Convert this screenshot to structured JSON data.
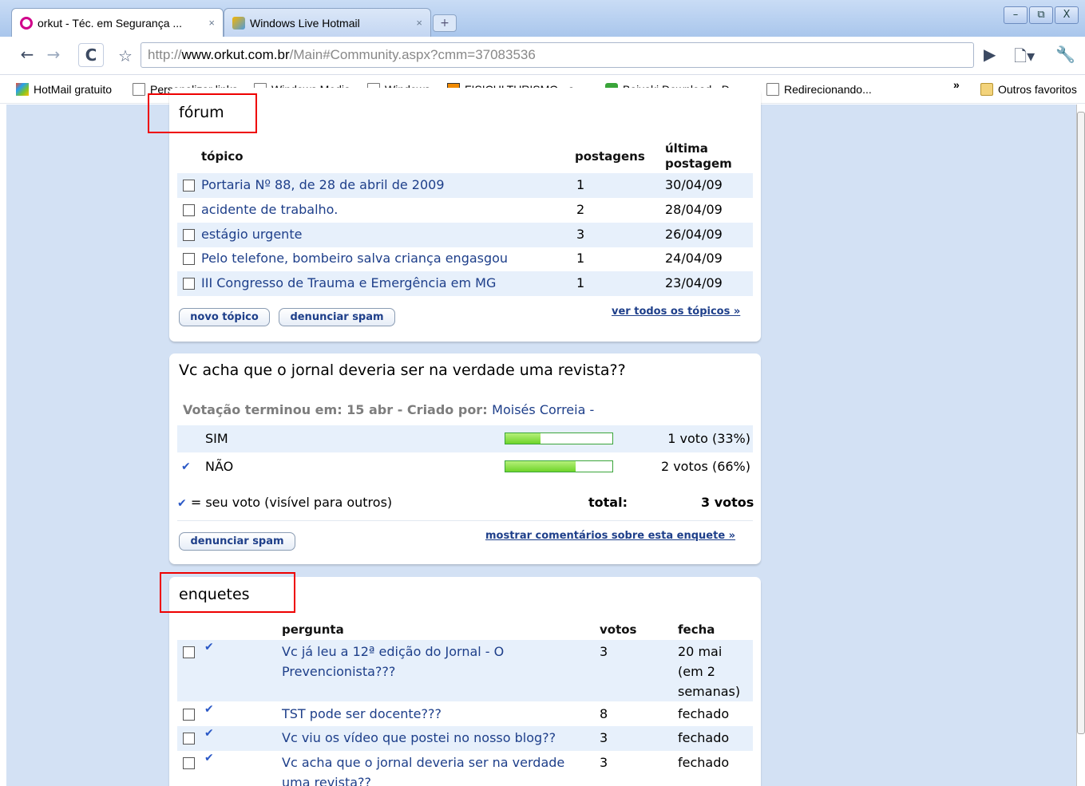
{
  "browser": {
    "tabs": [
      {
        "title": "orkut - Téc. em Segurança ...",
        "close": "×"
      },
      {
        "title": "Windows Live Hotmail",
        "close": "×"
      }
    ],
    "new_tab_label": "+",
    "window_buttons": {
      "minimize": "–",
      "restore": "⧉",
      "close": "X"
    },
    "nav": {
      "back": "←",
      "forward": "→",
      "reload": "C",
      "star": "☆"
    },
    "url_prefix": "http://",
    "url_domain": "www.orkut.com.br",
    "url_path": "/Main#Community.aspx?cmm=37083536",
    "bookmarks": [
      {
        "label": "HotMail gratuito",
        "icon": "hotmail-icon"
      },
      {
        "label": "Personalizar links",
        "icon": "page-icon"
      },
      {
        "label": "Windows Media",
        "icon": "page-icon"
      },
      {
        "label": "Windows",
        "icon": "page-icon"
      },
      {
        "label": "FISICULTURISMO - a...",
        "icon": "fisiculturismo-icon"
      },
      {
        "label": "Baixaki Download - D...",
        "icon": "baixaki-icon"
      },
      {
        "label": "Redirecionando...",
        "icon": "page-icon"
      }
    ],
    "bookmarks_overflow": "»",
    "other_bookmarks": "Outros favoritos"
  },
  "forum": {
    "title": "fórum",
    "headers": {
      "topic": "tópico",
      "posts": "postagens",
      "last_post_1": "última",
      "last_post_2": "postagem"
    },
    "rows": [
      {
        "topic": "Portaria Nº 88, de 28 de abril de 2009",
        "posts": "1",
        "date": "30/04/09"
      },
      {
        "topic": "acidente de trabalho.",
        "posts": "2",
        "date": "28/04/09"
      },
      {
        "topic": "estágio urgente",
        "posts": "3",
        "date": "26/04/09"
      },
      {
        "topic": "Pelo telefone, bombeiro salva criança engasgou",
        "posts": "1",
        "date": "24/04/09"
      },
      {
        "topic": "III Congresso de Trauma e Emergência em MG",
        "posts": "1",
        "date": "23/04/09"
      }
    ],
    "new_topic": "novo tópico",
    "report_spam": "denunciar spam",
    "see_all": "ver todos os tópicos »"
  },
  "poll": {
    "question": "Vc acha que o jornal deveria ser na verdade uma revista??",
    "meta_label": "Votação terminou em: 15 abr - Criado por:",
    "creator": "Moisés Correia -",
    "options": [
      {
        "label": "SIM",
        "result": "1 voto (33%)",
        "fraction": 0.33,
        "my_vote": false
      },
      {
        "label": "NÃO",
        "result": "2 votos (66%)",
        "fraction": 0.66,
        "my_vote": true
      }
    ],
    "legend": "= seu voto (visível para outros)",
    "total_label": "total:",
    "total_value": "3 votos",
    "report_spam": "denunciar spam",
    "show_comments": "mostrar comentários sobre esta enquete »",
    "check": "✔"
  },
  "polls": {
    "title": "enquetes",
    "headers": {
      "question": "pergunta",
      "votes": "votos",
      "closes": "fecha"
    },
    "rows": [
      {
        "q1": "Vc já leu a 12ª edição do Jornal - O",
        "q2": "Prevencionista???",
        "votes": "3",
        "c1": "20 mai",
        "c2": "(em 2",
        "c3": "semanas)"
      },
      {
        "q1": "TST pode ser docente???",
        "votes": "8",
        "c1": "fechado"
      },
      {
        "q1": "Vc viu os vídeo que postei no nosso blog??",
        "votes": "3",
        "c1": "fechado"
      },
      {
        "q1": "Vc acha que o jornal deveria ser na verdade",
        "q2": "uma revista??",
        "votes": "3",
        "c1": "fechado"
      }
    ]
  }
}
